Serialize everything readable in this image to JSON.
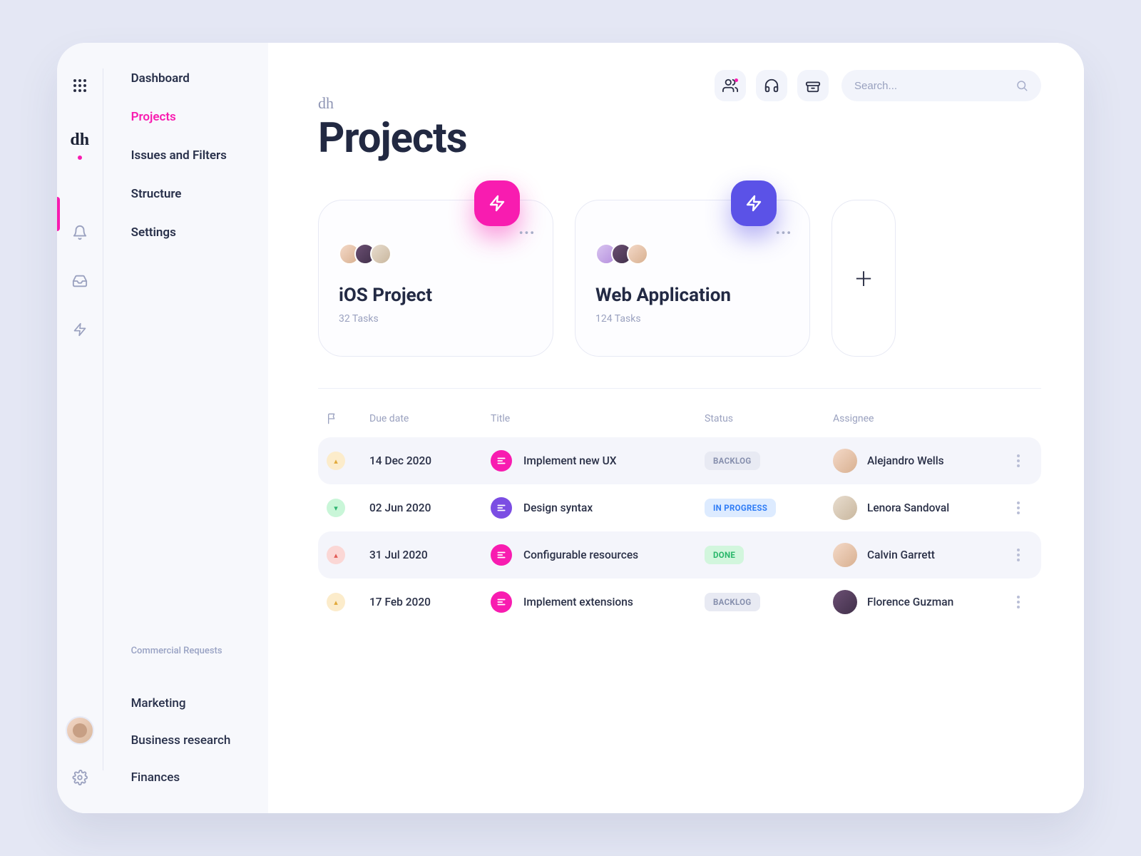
{
  "brand": "dh",
  "rail": {
    "items": [
      "apps",
      "logo",
      "bell",
      "inbox",
      "bolt"
    ],
    "active": "logo"
  },
  "sidebar": {
    "items": [
      {
        "label": "Dashboard"
      },
      {
        "label": "Projects",
        "active": true
      },
      {
        "label": "Issues and Filters"
      },
      {
        "label": "Structure"
      },
      {
        "label": "Settings"
      }
    ],
    "section_title": "Commercial Requests",
    "section_items": [
      {
        "label": "Marketing"
      },
      {
        "label": "Business research"
      },
      {
        "label": "Finances"
      }
    ]
  },
  "header": {
    "brand": "dh",
    "title": "Projects",
    "search_placeholder": "Search..."
  },
  "cards": [
    {
      "title": "iOS Project",
      "subtitle": "32 Tasks",
      "badge_color": "pink"
    },
    {
      "title": "Web Application",
      "subtitle": "124 Tasks",
      "badge_color": "indigo"
    }
  ],
  "table": {
    "columns": {
      "flag": "",
      "due": "Due date",
      "title": "Title",
      "status": "Status",
      "assignee": "Assignee"
    },
    "rows": [
      {
        "flag": "amber",
        "flag_glyph": "▴",
        "due": "14 Dec 2020",
        "title": "Implement new UX",
        "title_color": "pink",
        "status": "BACKLOG",
        "status_kind": "backlog",
        "assignee": "Alejandro Wells",
        "hl": true,
        "av": "c1"
      },
      {
        "flag": "green",
        "flag_glyph": "▾",
        "due": "02 Jun 2020",
        "title": "Design syntax",
        "title_color": "purple",
        "status": "IN PROGRESS",
        "status_kind": "progress",
        "assignee": "Lenora Sandoval",
        "hl": false,
        "av": "c3"
      },
      {
        "flag": "rose",
        "flag_glyph": "▴",
        "due": "31 Jul 2020",
        "title": "Configurable resources",
        "title_color": "pink",
        "status": "DONE",
        "status_kind": "done",
        "assignee": "Calvin Garrett",
        "hl": true,
        "av": "c1"
      },
      {
        "flag": "amber",
        "flag_glyph": "▴",
        "due": "17 Feb 2020",
        "title": "Implement extensions",
        "title_color": "pink",
        "status": "BACKLOG",
        "status_kind": "backlog",
        "assignee": "Florence Guzman",
        "hl": false,
        "av": "c2"
      }
    ]
  }
}
